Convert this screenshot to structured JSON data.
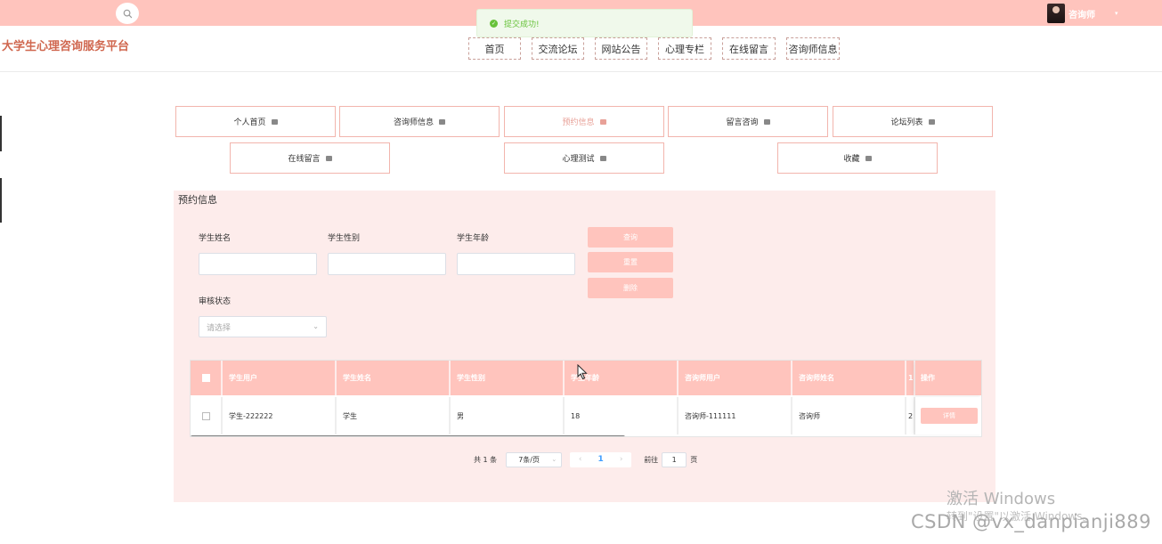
{
  "header": {
    "user_name": "咨询师",
    "caret": "▾",
    "logo": "大学生心理咨询服务平台"
  },
  "toast": {
    "icon": "check-circle-icon",
    "text": "提交成功!",
    "color": "#67c23a"
  },
  "nav": {
    "items": [
      "首页",
      "交流论坛",
      "网站公告",
      "心理专栏",
      "在线留言",
      "咨询师信息"
    ]
  },
  "menu": {
    "row1": [
      "个人首页",
      "咨询师信息",
      "预约信息",
      "留言咨询",
      "论坛列表"
    ],
    "row2": [
      "在线留言",
      "心理测试",
      "收藏"
    ],
    "active": "预约信息"
  },
  "panel": {
    "title": "预约信息",
    "filters": {
      "student_name_label": "学生姓名",
      "student_gender_label": "学生性别",
      "student_age_label": "学生年龄",
      "review_status_label": "审核状态",
      "review_status_placeholder": "请选择",
      "select_caret": "⌄"
    },
    "buttons": {
      "query": "查询",
      "reset": "重置",
      "delete": "删除"
    }
  },
  "table": {
    "columns": [
      "学生用户",
      "学生姓名",
      "学生性别",
      "学生年龄",
      "咨询师用户",
      "咨询师姓名",
      "1"
    ],
    "op_header": "操作",
    "rows": [
      {
        "cells": [
          "学生-222222",
          "学生",
          "男",
          "18",
          "咨询师-111111",
          "咨询师",
          "2"
        ],
        "action": "详情"
      }
    ]
  },
  "pagination": {
    "total": "共 1 条",
    "page_size": "7条/页",
    "prev": "‹",
    "current": "1",
    "next": "›",
    "goto_label": "前往",
    "goto_value": "1",
    "goto_suffix": "页"
  },
  "overlays": {
    "activate_windows": "激活 Windows",
    "activate_hint": "转到\"设置\"以激活 Windows。",
    "csdn": "CSDN @vx_danpianji889"
  },
  "colors": {
    "accent": "#ffc4bd",
    "panel_bg": "#fdeceb",
    "logo": "#d0674f",
    "active_menu": "#e8a198"
  }
}
